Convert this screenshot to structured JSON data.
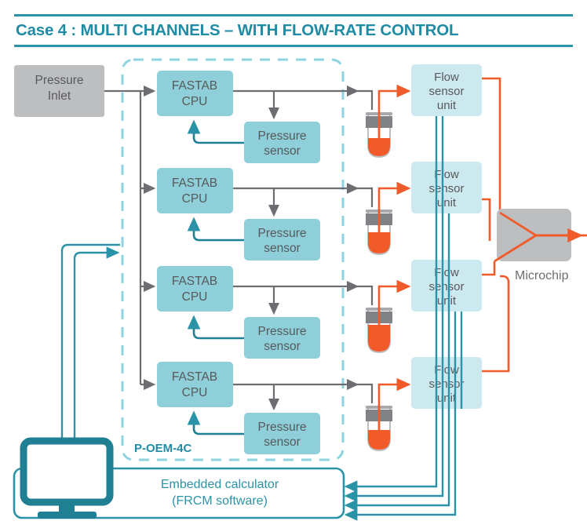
{
  "header": {
    "title": "Case 4 : MULTI CHANNELS – WITH FLOW-RATE CONTROL",
    "rule_color": "#2e93a8",
    "title_color": "#1f8ca5"
  },
  "colors": {
    "cpu_box": "#8ecfd9",
    "flow_box": "#cde9f0",
    "inlet_box": "#bcbec0",
    "microchip_box": "#bcbec0",
    "teal_line": "#2b93a8",
    "orange_line": "#f15a29",
    "gray_line": "#6d6e71",
    "dashed_border": "#8ed3e0",
    "calc_border": "#2b93a8"
  },
  "nodes": {
    "pressure_inlet": {
      "label_line1": "Pressure",
      "label_line2": "Inlet"
    },
    "module": {
      "label": "P-OEM-4C"
    },
    "microchip": {
      "label": "Microchip"
    },
    "calculator": {
      "label_line1": "Embedded calculator",
      "label_line2": "(FRCM software)"
    },
    "cpu": {
      "label_line1": "FASTAB",
      "label_line2": "CPU"
    },
    "pressure_sensor": {
      "label_line1": "Pressure",
      "label_line2": "sensor"
    },
    "flow_sensor": {
      "label_line1": "Flow",
      "label_line2": "sensor",
      "label_line3": "unit"
    }
  },
  "channels": [
    {
      "index": 1,
      "cpu": "FASTAB CPU",
      "pressure_sensor": "Pressure sensor",
      "flow_sensor": "Flow sensor unit",
      "vial": "sample-vial"
    },
    {
      "index": 2,
      "cpu": "FASTAB CPU",
      "pressure_sensor": "Pressure sensor",
      "flow_sensor": "Flow sensor unit",
      "vial": "sample-vial"
    },
    {
      "index": 3,
      "cpu": "FASTAB CPU",
      "pressure_sensor": "Pressure sensor",
      "flow_sensor": "Flow sensor unit",
      "vial": "sample-vial"
    },
    {
      "index": 4,
      "cpu": "FASTAB CPU",
      "pressure_sensor": "Pressure sensor",
      "flow_sensor": "Flow sensor unit",
      "vial": "sample-vial"
    }
  ],
  "icons": {
    "monitor": "monitor-icon",
    "vial": "vial-icon",
    "arrow": "arrow-head"
  }
}
